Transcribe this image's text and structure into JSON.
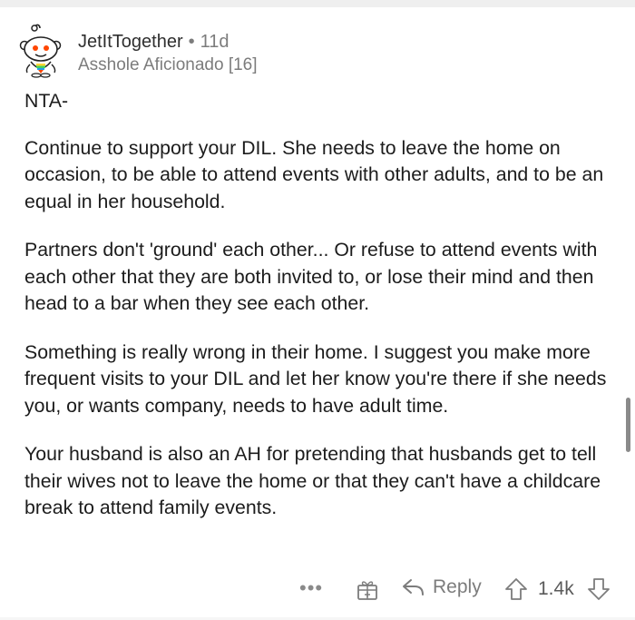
{
  "comment": {
    "username": "JetItTogether",
    "separator": "•",
    "time_ago": "11d",
    "flair": "Asshole Aficionado [16]",
    "paragraphs": [
      "NTA-",
      "Continue to support your DIL. She needs to leave the home on occasion, to be able to attend events with other adults, and to be an equal in her household.",
      "Partners don't 'ground' each other... Or refuse to attend events with each other that they are both invited to, or lose their mind and then head to a bar when they see each other.",
      "Something is really wrong in their home. I suggest you make more frequent visits to your DIL and let her know you're there if she needs you, or wants company, needs to have adult time.",
      "Your husband is also an AH for pretending that husbands get to tell their wives not to leave the home or that they can't have a childcare break to attend family events."
    ]
  },
  "actions": {
    "more_label": "•••",
    "reply_label": "Reply",
    "score": "1.4k"
  },
  "icons": {
    "avatar": "reddit-snoo-avatar-icon",
    "award": "award-gift-icon",
    "reply": "reply-arrow-icon",
    "upvote": "upvote-arrow-icon",
    "downvote": "downvote-arrow-icon"
  },
  "colors": {
    "text": "#1c1c1c",
    "meta": "#7c7c7c",
    "background": "#ffffff"
  }
}
